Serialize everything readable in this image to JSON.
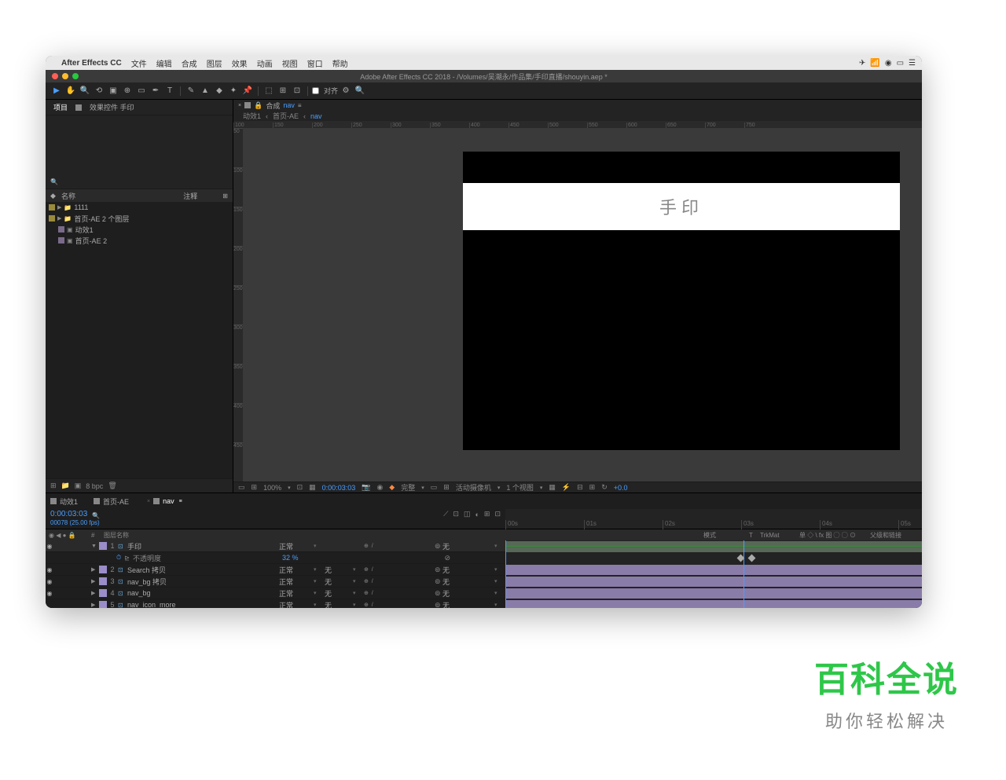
{
  "macmenu": {
    "app": "After Effects CC",
    "items": [
      "文件",
      "编辑",
      "合成",
      "图层",
      "效果",
      "动画",
      "视图",
      "窗口",
      "帮助"
    ]
  },
  "titlebar": "Adobe After Effects CC 2018 - /Volumes/吴潮永/作品集/手印直播/shouyin.aep *",
  "toolbar": {
    "align": "对齐"
  },
  "project": {
    "tab1": "项目",
    "tab2": "效果控件 手印",
    "searchIcon": "🔍",
    "col_name": "名称",
    "col_comment": "注释",
    "items": [
      {
        "name": "1111",
        "type": "folder"
      },
      {
        "name": "首页-AE 2 个图层",
        "type": "folder"
      },
      {
        "name": "动效1",
        "type": "comp"
      },
      {
        "name": "首页-AE 2",
        "type": "comp"
      }
    ],
    "bpc": "8 bpc"
  },
  "viewer": {
    "lock": "🔒",
    "compLabel": "合成",
    "compName": "nav",
    "crumbs": [
      "动效1",
      "首页-AE",
      "nav"
    ],
    "navbarText": "手印",
    "zoom": "100%",
    "time": "0:00:03:03",
    "quality": "完整",
    "camera": "活动摄像机",
    "views": "1 个视图",
    "exposure": "+0.0"
  },
  "timeline": {
    "tabs": [
      {
        "name": "动效1"
      },
      {
        "name": "首页-AE"
      },
      {
        "name": "nav",
        "sel": true
      }
    ],
    "timecode": "0:00:03:03",
    "frameinfo": "00078 (25.00 fps)",
    "cols": {
      "layerName": "图层名称",
      "mode": "模式",
      "trkmat": "TrkMat",
      "parent": "父级和链接",
      "switches": "单 ◇ \\ fx 图 ◯ ◯ ⊙"
    },
    "ticks": [
      "00s",
      "01s",
      "02s",
      "03s",
      "04s",
      "05s"
    ],
    "layers": [
      {
        "n": 1,
        "name": "手印",
        "mode": "正常",
        "trk": "",
        "par": "无",
        "open": true
      },
      {
        "n": 2,
        "name": "Search 拷贝",
        "mode": "正常",
        "trk": "无",
        "par": "无"
      },
      {
        "n": 3,
        "name": "nav_bg 拷贝",
        "mode": "正常",
        "trk": "无",
        "par": "无"
      },
      {
        "n": 4,
        "name": "nav_bg",
        "mode": "正常",
        "trk": "无",
        "par": "无"
      },
      {
        "n": 5,
        "name": "nav_icon_more",
        "mode": "正常",
        "trk": "无",
        "par": "无"
      }
    ],
    "prop": {
      "name": "不透明度",
      "value": "32 %",
      "link": "⊘"
    }
  },
  "watermark": {
    "title": "百科全说",
    "sub": "助你轻松解决"
  }
}
